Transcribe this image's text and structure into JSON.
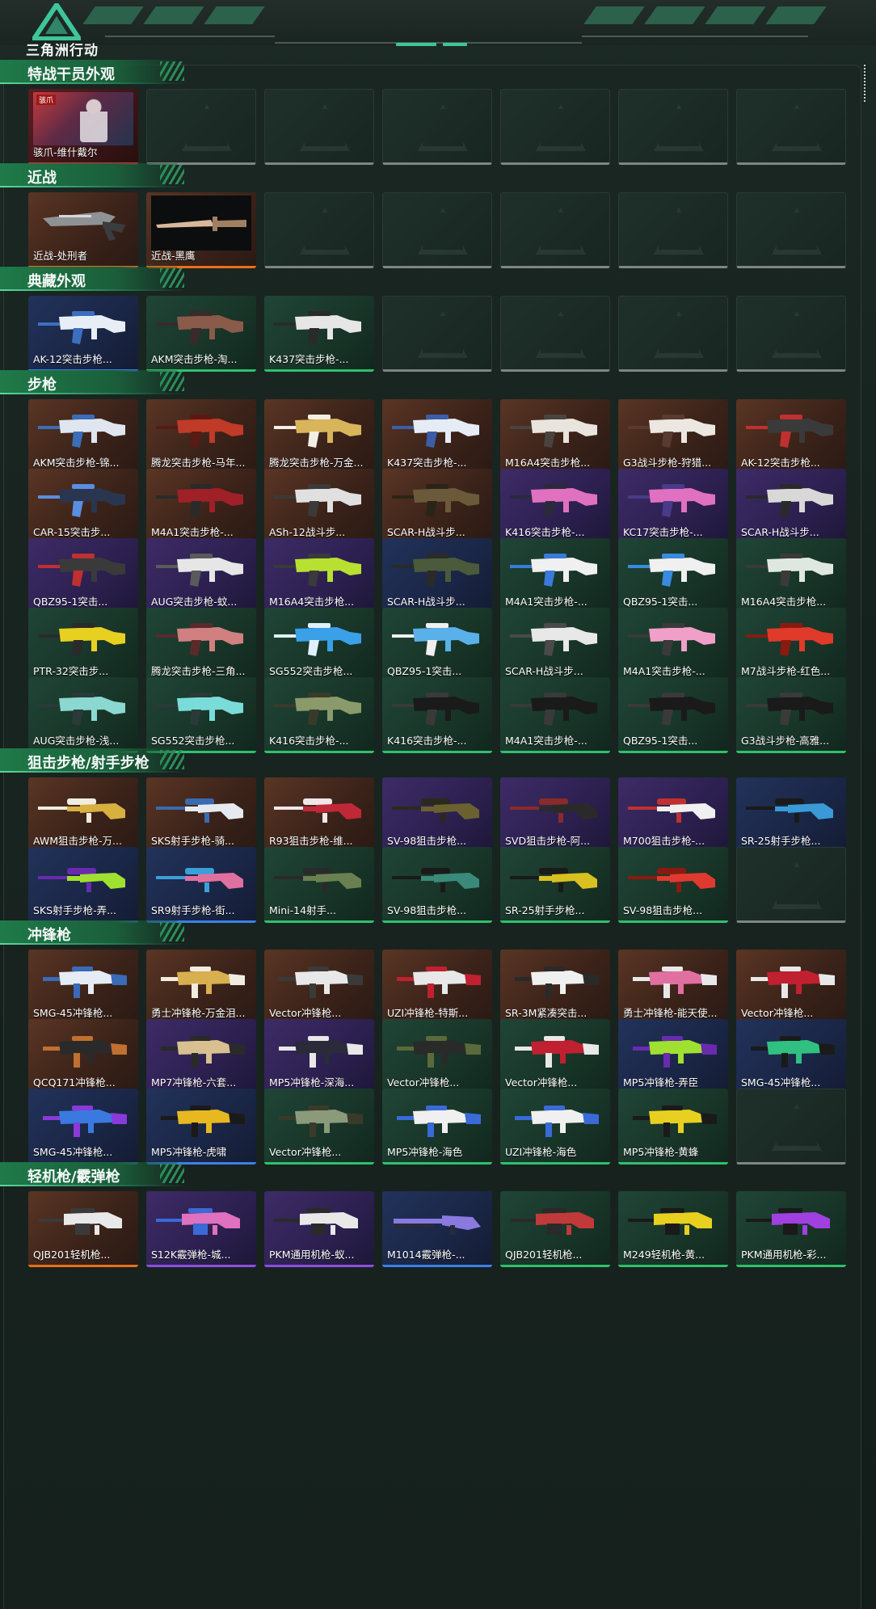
{
  "app": {
    "title": "三角洲行动",
    "colors": {
      "accent": "#3ec59a",
      "section_green": "#1f7a49"
    }
  },
  "sections": [
    {
      "title": "特战干员外观",
      "items": [
        {
          "label": "骇爪-维什戴尔",
          "rarity": "red",
          "kind": "operator",
          "tag": "骇爪"
        },
        null,
        null,
        null,
        null,
        null,
        null
      ]
    },
    {
      "title": "近战",
      "items": [
        {
          "label": "近战-处刑者",
          "rarity": "orange",
          "kind": "melee",
          "colors": [
            "#8f9294",
            "#3a3c3e"
          ]
        },
        {
          "label": "近战-黑鹰",
          "rarity": "orange",
          "kind": "blade",
          "colors": [
            "#d9b89b",
            "#a08060"
          ]
        },
        null,
        null,
        null,
        null,
        null
      ]
    },
    {
      "title": "典藏外观",
      "items": [
        {
          "label": "AK-12突击步枪...",
          "rarity": "blue",
          "kind": "rifle",
          "colors": [
            "#e8eef5",
            "#3d6fbf"
          ]
        },
        {
          "label": "AKM突击步枪-淘...",
          "rarity": "green",
          "kind": "rifle",
          "colors": [
            "#8a5a4a",
            "#3a2a2a"
          ]
        },
        {
          "label": "K437突击步枪-...",
          "rarity": "green",
          "kind": "rifle",
          "colors": [
            "#e6e6e6",
            "#2a2a2a"
          ]
        },
        null,
        null,
        null,
        null
      ]
    },
    {
      "title": "步枪",
      "items": [
        {
          "label": "AKM突击步枪-锦...",
          "rarity": "orange",
          "kind": "rifle",
          "colors": [
            "#dfe6f0",
            "#3b6db8"
          ]
        },
        {
          "label": "腾龙突击步枪-马年...",
          "rarity": "orange",
          "kind": "rifle",
          "colors": [
            "#c03a28",
            "#5a1a14"
          ]
        },
        {
          "label": "腾龙突击步枪-万金...",
          "rarity": "orange",
          "kind": "rifle",
          "colors": [
            "#d8b55a",
            "#f3efe6"
          ]
        },
        {
          "label": "K437突击步枪-...",
          "rarity": "orange",
          "kind": "rifle",
          "colors": [
            "#e6ecf5",
            "#3a5fa8"
          ]
        },
        {
          "label": "M16A4突击步枪...",
          "rarity": "orange",
          "kind": "rifle",
          "colors": [
            "#e9e4de",
            "#4a4440"
          ]
        },
        {
          "label": "G3战斗步枪-狩猎...",
          "rarity": "orange",
          "kind": "rifle",
          "colors": [
            "#ece7e0",
            "#5a3a30"
          ]
        },
        {
          "label": "AK-12突击步枪...",
          "rarity": "orange",
          "kind": "rifle",
          "colors": [
            "#3a3a3a",
            "#c03030"
          ]
        },
        {
          "label": "CAR-15突击步...",
          "rarity": "orange",
          "kind": "rifle",
          "colors": [
            "#2a3550",
            "#5a8ee0"
          ]
        },
        {
          "label": "M4A1突击步枪-...",
          "rarity": "orange",
          "kind": "rifle",
          "colors": [
            "#a02028",
            "#2a2a2a"
          ]
        },
        {
          "label": "ASh-12战斗步...",
          "rarity": "orange",
          "kind": "rifle",
          "colors": [
            "#e0e0e0",
            "#3a3a3a"
          ]
        },
        {
          "label": "SCAR-H战斗步...",
          "rarity": "orange",
          "kind": "rifle",
          "colors": [
            "#6a5a3a",
            "#2a2418"
          ]
        },
        {
          "label": "K416突击步枪-...",
          "rarity": "purple",
          "kind": "rifle",
          "colors": [
            "#e070c0",
            "#2a2a3a"
          ]
        },
        {
          "label": "KC17突击步枪-...",
          "rarity": "purple",
          "kind": "rifle",
          "colors": [
            "#e070c0",
            "#4a3a8a"
          ]
        },
        {
          "label": "SCAR-H战斗步...",
          "rarity": "purple",
          "kind": "rifle",
          "colors": [
            "#d8d8d8",
            "#2a2a2a"
          ]
        },
        {
          "label": "QBZ95-1突击...",
          "rarity": "purple",
          "kind": "rifle",
          "colors": [
            "#3a3a3a",
            "#c03030"
          ]
        },
        {
          "label": "AUG突击步枪-蚊...",
          "rarity": "purple",
          "kind": "rifle",
          "colors": [
            "#e6e6e6",
            "#5a5a5a"
          ]
        },
        {
          "label": "M16A4突击步枪...",
          "rarity": "purple",
          "kind": "rifle",
          "colors": [
            "#b8e030",
            "#3a3a3a"
          ]
        },
        {
          "label": "SCAR-H战斗步...",
          "rarity": "blue",
          "kind": "rifle",
          "colors": [
            "#4a5a3a",
            "#2a2a2a"
          ]
        },
        {
          "label": "M4A1突击步枪-...",
          "rarity": "green",
          "kind": "rifle",
          "colors": [
            "#f0f0f0",
            "#3a7ad8"
          ]
        },
        {
          "label": "QBZ95-1突击...",
          "rarity": "green",
          "kind": "rifle",
          "colors": [
            "#f0f0f0",
            "#3a8ae0"
          ]
        },
        {
          "label": "M16A4突击步枪...",
          "rarity": "green",
          "kind": "rifle",
          "colors": [
            "#dfe8e0",
            "#3a3a3a"
          ]
        },
        {
          "label": "PTR-32突击步...",
          "rarity": "green",
          "kind": "rifle",
          "colors": [
            "#e8d020",
            "#2a2a2a"
          ]
        },
        {
          "label": "腾龙突击步枪-三角...",
          "rarity": "green",
          "kind": "rifle",
          "colors": [
            "#d08080",
            "#5a2a2a"
          ]
        },
        {
          "label": "SG552突击步枪...",
          "rarity": "green",
          "kind": "rifle",
          "colors": [
            "#3aa0e8",
            "#e0f0ff"
          ]
        },
        {
          "label": "QBZ95-1突击...",
          "rarity": "green",
          "kind": "rifle",
          "colors": [
            "#5ab0e8",
            "#f0f0f0"
          ]
        },
        {
          "label": "SCAR-H战斗步...",
          "rarity": "green",
          "kind": "rifle",
          "colors": [
            "#e8e8e8",
            "#4a4a4a"
          ]
        },
        {
          "label": "M4A1突击步枪-...",
          "rarity": "green",
          "kind": "rifle",
          "colors": [
            "#f0a0c8",
            "#3a3a3a"
          ]
        },
        {
          "label": "M7战斗步枪-红色...",
          "rarity": "green",
          "kind": "rifle",
          "colors": [
            "#e03a2a",
            "#8a1a10"
          ]
        },
        {
          "label": "AUG突击步枪-浅...",
          "rarity": "green",
          "kind": "rifle",
          "colors": [
            "#8ad8d0",
            "#2a3a38"
          ]
        },
        {
          "label": "SG552突击步枪...",
          "rarity": "green",
          "kind": "rifle",
          "colors": [
            "#7adcd8",
            "#2a3a38"
          ]
        },
        {
          "label": "K416突击步枪-...",
          "rarity": "green",
          "kind": "rifle",
          "colors": [
            "#8a9a6a",
            "#3a3a2a"
          ]
        },
        {
          "label": "K416突击步枪-...",
          "rarity": "green",
          "kind": "rifle",
          "colors": [
            "#1a1a1a",
            "#3a3a3a"
          ]
        },
        {
          "label": "M4A1突击步枪-...",
          "rarity": "green",
          "kind": "rifle",
          "colors": [
            "#1a1a1a",
            "#3a3a3a"
          ]
        },
        {
          "label": "QBZ95-1突击...",
          "rarity": "green",
          "kind": "rifle",
          "colors": [
            "#1a1a1a",
            "#3a3a3a"
          ]
        },
        {
          "label": "G3战斗步枪-高雅...",
          "rarity": "green",
          "kind": "rifle",
          "colors": [
            "#1a1a1a",
            "#3a3a3a"
          ]
        }
      ]
    },
    {
      "title": "狙击步枪/射手步枪",
      "items": [
        {
          "label": "AWM狙击步枪-万...",
          "rarity": "orange",
          "kind": "sniper",
          "colors": [
            "#d8b040",
            "#f0ece0"
          ]
        },
        {
          "label": "SKS射手步枪-骑...",
          "rarity": "orange",
          "kind": "sniper",
          "colors": [
            "#e6eaf0",
            "#3a6ab0"
          ]
        },
        {
          "label": "R93狙击步枪-维...",
          "rarity": "orange",
          "kind": "sniper",
          "colors": [
            "#c02838",
            "#f0e6e8"
          ]
        },
        {
          "label": "SV-98狙击步枪...",
          "rarity": "purple",
          "kind": "sniper",
          "colors": [
            "#6a6030",
            "#2a2a1a"
          ]
        },
        {
          "label": "SVD狙击步枪-阿...",
          "rarity": "purple",
          "kind": "sniper",
          "colors": [
            "#2a2a2a",
            "#8a2a2a"
          ]
        },
        {
          "label": "M700狙击步枪-...",
          "rarity": "purple",
          "kind": "sniper",
          "colors": [
            "#f0f0f0",
            "#c03030"
          ]
        },
        {
          "label": "SR-25射手步枪...",
          "rarity": "blue",
          "kind": "sniper",
          "colors": [
            "#3a9ad8",
            "#1a1a1a"
          ]
        },
        {
          "label": "SKS射手步枪-弄...",
          "rarity": "blue",
          "kind": "sniper",
          "colors": [
            "#a0e030",
            "#6a2ab0"
          ]
        },
        {
          "label": "SR9射手步枪-街...",
          "rarity": "blue",
          "kind": "sniper",
          "colors": [
            "#e070a0",
            "#3aa0d8"
          ]
        },
        {
          "label": "Mini-14射手...",
          "rarity": "green",
          "kind": "sniper",
          "colors": [
            "#6a8050",
            "#2a2a2a"
          ]
        },
        {
          "label": "SV-98狙击步枪...",
          "rarity": "green",
          "kind": "sniper",
          "colors": [
            "#3a8a7a",
            "#1a1a1a"
          ]
        },
        {
          "label": "SR-25射手步枪...",
          "rarity": "green",
          "kind": "sniper",
          "colors": [
            "#d8c020",
            "#1a1a1a"
          ]
        },
        {
          "label": "SV-98狙击步枪...",
          "rarity": "green",
          "kind": "sniper",
          "colors": [
            "#e03a30",
            "#8a1a10"
          ]
        },
        null
      ]
    },
    {
      "title": "冲锋枪",
      "items": [
        {
          "label": "SMG-45冲锋枪...",
          "rarity": "orange",
          "kind": "smg",
          "colors": [
            "#e6ecf5",
            "#3a6ab8"
          ]
        },
        {
          "label": "勇士冲锋枪-万金泪...",
          "rarity": "orange",
          "kind": "smg",
          "colors": [
            "#d8b050",
            "#f0ece0"
          ]
        },
        {
          "label": "Vector冲锋枪...",
          "rarity": "orange",
          "kind": "smg",
          "colors": [
            "#e8e8e8",
            "#3a3a3a"
          ]
        },
        {
          "label": "UZI冲锋枪-特斯...",
          "rarity": "orange",
          "kind": "smg",
          "colors": [
            "#e8e8e8",
            "#c02030"
          ]
        },
        {
          "label": "SR-3M紧凑突击...",
          "rarity": "orange",
          "kind": "smg",
          "colors": [
            "#f0f0f0",
            "#2a2a2a"
          ]
        },
        {
          "label": "勇士冲锋枪-能天使...",
          "rarity": "orange",
          "kind": "smg",
          "colors": [
            "#e070a0",
            "#e8e8e8"
          ]
        },
        {
          "label": "Vector冲锋枪...",
          "rarity": "orange",
          "kind": "smg",
          "colors": [
            "#c02030",
            "#e8e8e8"
          ]
        },
        {
          "label": "QCQ171冲锋枪...",
          "rarity": "orange",
          "kind": "smg",
          "colors": [
            "#2a2a2a",
            "#c07030"
          ]
        },
        {
          "label": "MP7冲锋枪-六套...",
          "rarity": "purple",
          "kind": "smg",
          "colors": [
            "#d8c090",
            "#2a2a2a"
          ]
        },
        {
          "label": "MP5冲锋枪-深海...",
          "rarity": "purple",
          "kind": "smg",
          "colors": [
            "#2a2a3a",
            "#e8e8e8"
          ]
        },
        {
          "label": "Vector冲锋枪...",
          "rarity": "green",
          "kind": "smg",
          "colors": [
            "#2a2a2a",
            "#5a6a3a"
          ]
        },
        {
          "label": "Vector冲锋枪...",
          "rarity": "green",
          "kind": "smg",
          "colors": [
            "#c02030",
            "#e8e8e8"
          ]
        },
        {
          "label": "MP5冲锋枪-弄臣",
          "rarity": "blue",
          "kind": "smg",
          "colors": [
            "#a0e030",
            "#6a2ab0"
          ]
        },
        {
          "label": "SMG-45冲锋枪...",
          "rarity": "blue",
          "kind": "smg",
          "colors": [
            "#30c080",
            "#1a1a1a"
          ]
        },
        {
          "label": "SMG-45冲锋枪...",
          "rarity": "blue",
          "kind": "smg",
          "colors": [
            "#3a7ae0",
            "#8a3ad8"
          ]
        },
        {
          "label": "MP5冲锋枪-虎啸",
          "rarity": "blue",
          "kind": "smg",
          "colors": [
            "#e8b820",
            "#1a1a1a"
          ]
        },
        {
          "label": "Vector冲锋枪...",
          "rarity": "green",
          "kind": "smg",
          "colors": [
            "#8a9a7a",
            "#3a3a2a"
          ]
        },
        {
          "label": "MP5冲锋枪-海色",
          "rarity": "green",
          "kind": "smg",
          "colors": [
            "#f0f0f0",
            "#3a6ad8"
          ]
        },
        {
          "label": "UZI冲锋枪-海色",
          "rarity": "green",
          "kind": "smg",
          "colors": [
            "#f0f0f0",
            "#3a6ad8"
          ]
        },
        {
          "label": "MP5冲锋枪-黄蜂",
          "rarity": "green",
          "kind": "smg",
          "colors": [
            "#e8d020",
            "#1a1a1a"
          ]
        },
        null
      ]
    },
    {
      "title": "轻机枪/霰弹枪",
      "items": [
        {
          "label": "QJB201轻机枪...",
          "rarity": "orange",
          "kind": "lmg",
          "colors": [
            "#e8e8e8",
            "#3a3a3a"
          ]
        },
        {
          "label": "S12K霰弹枪-城...",
          "rarity": "purple",
          "kind": "lmg",
          "colors": [
            "#e070c0",
            "#3a6ad8"
          ]
        },
        {
          "label": "PKM通用机枪-蚁...",
          "rarity": "purple",
          "kind": "lmg",
          "colors": [
            "#e8e8e8",
            "#2a2a2a"
          ]
        },
        {
          "label": "M1014霰弹枪-...",
          "rarity": "blue",
          "kind": "shotgun",
          "colors": [
            "#8a7ae0",
            "#2a2a3a"
          ]
        },
        {
          "label": "QJB201轻机枪...",
          "rarity": "green",
          "kind": "lmg",
          "colors": [
            "#c03a3a",
            "#2a2a2a"
          ]
        },
        {
          "label": "M249轻机枪-黄...",
          "rarity": "green",
          "kind": "lmg",
          "colors": [
            "#e8d020",
            "#1a1a1a"
          ]
        },
        {
          "label": "PKM通用机枪-彩...",
          "rarity": "green",
          "kind": "lmg",
          "colors": [
            "#a040e0",
            "#1a1a1a"
          ]
        }
      ]
    }
  ]
}
